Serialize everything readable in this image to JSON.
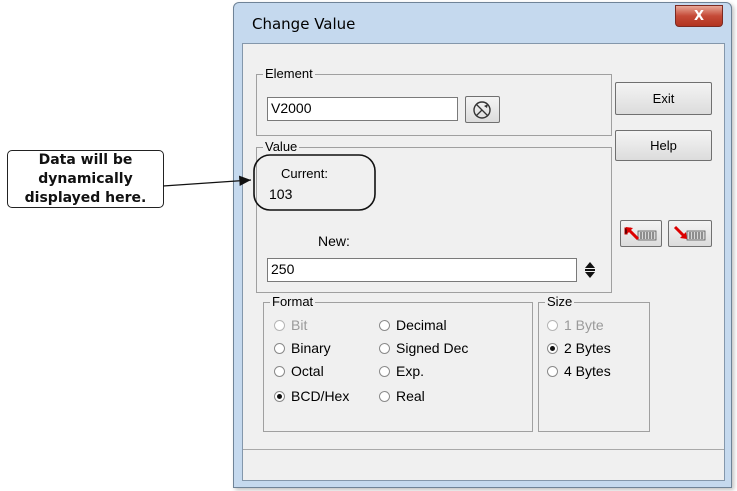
{
  "callout": {
    "text": "Data will be\ndynamically\ndisplayed here."
  },
  "window": {
    "title": "Change Value",
    "close_label": "X"
  },
  "element": {
    "legend": "Element",
    "value": "V2000",
    "lookup_icon": "element-browse-icon"
  },
  "buttons": {
    "exit": "Exit",
    "help": "Help"
  },
  "value": {
    "legend": "Value",
    "current_label": "Current:",
    "current_value": "103",
    "new_label": "New:",
    "new_value": "250"
  },
  "format": {
    "legend": "Format",
    "options": [
      {
        "label": "Bit",
        "checked": false,
        "enabled": false
      },
      {
        "label": "Decimal",
        "checked": false,
        "enabled": true
      },
      {
        "label": "Binary",
        "checked": false,
        "enabled": true
      },
      {
        "label": "Signed Dec",
        "checked": false,
        "enabled": true
      },
      {
        "label": "Octal",
        "checked": false,
        "enabled": true
      },
      {
        "label": "Exp.",
        "checked": false,
        "enabled": true
      },
      {
        "label": "BCD/Hex",
        "checked": true,
        "enabled": true
      },
      {
        "label": "Real",
        "checked": false,
        "enabled": true
      }
    ]
  },
  "size": {
    "legend": "Size",
    "options": [
      {
        "label": "1 Byte",
        "checked": false,
        "enabled": false
      },
      {
        "label": "2 Bytes",
        "checked": true,
        "enabled": true
      },
      {
        "label": "4 Bytes",
        "checked": false,
        "enabled": true
      }
    ]
  }
}
